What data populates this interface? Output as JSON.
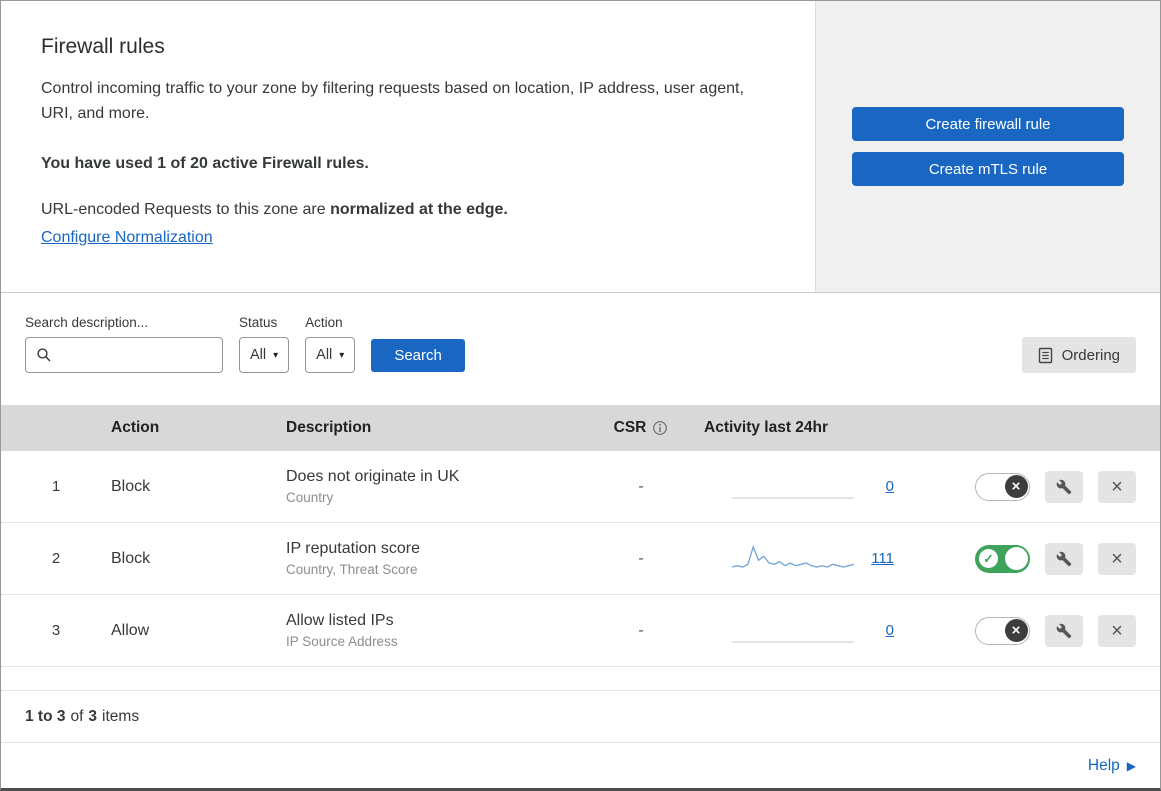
{
  "colors": {
    "accent_blue": "#1967c2",
    "link_blue": "#1766c0",
    "toggle_green": "#3fa35c",
    "sparkline_blue": "#79a7d9",
    "table_header_bg": "#d8d8d8",
    "panel_bg": "#f0f0f0"
  },
  "header": {
    "title": "Firewall rules",
    "description": "Control incoming traffic to your zone by filtering requests based on location, IP address, user agent, URI, and more.",
    "usage": "You have used 1 of 20 active Firewall rules.",
    "normalization_prefix": "URL-encoded Requests to this zone are ",
    "normalization_bold": "normalized at the edge.",
    "normalization_link": "Configure Normalization",
    "create_firewall_button": "Create firewall rule",
    "create_mtls_button": "Create mTLS rule"
  },
  "filters": {
    "search_label": "Search description...",
    "status_label": "Status",
    "status_value": "All",
    "action_label": "Action",
    "action_value": "All",
    "search_button": "Search",
    "ordering_button": "Ordering"
  },
  "table": {
    "headers": {
      "action": "Action",
      "description": "Description",
      "csr": "CSR",
      "activity": "Activity last 24hr"
    },
    "rows": [
      {
        "index": "1",
        "action": "Block",
        "description": "Does not originate in UK",
        "fields": "Country",
        "csr": "-",
        "activity": "0",
        "enabled": false,
        "sparkline": []
      },
      {
        "index": "2",
        "action": "Block",
        "description": "IP reputation score",
        "fields": "Country, Threat Score",
        "csr": "-",
        "activity": "111",
        "enabled": true,
        "sparkline": [
          3,
          4,
          3,
          5,
          18,
          8,
          11,
          6,
          5,
          7,
          4,
          6,
          4,
          5,
          6,
          4,
          3,
          4,
          3,
          5,
          4,
          3,
          4,
          5
        ]
      },
      {
        "index": "3",
        "action": "Allow",
        "description": "Allow listed IPs",
        "fields": "IP Source Address",
        "csr": "-",
        "activity": "0",
        "enabled": false,
        "sparkline": []
      }
    ]
  },
  "footer": {
    "range": "1 to 3",
    "of": "of",
    "total": "3",
    "items": "items",
    "help": "Help"
  }
}
